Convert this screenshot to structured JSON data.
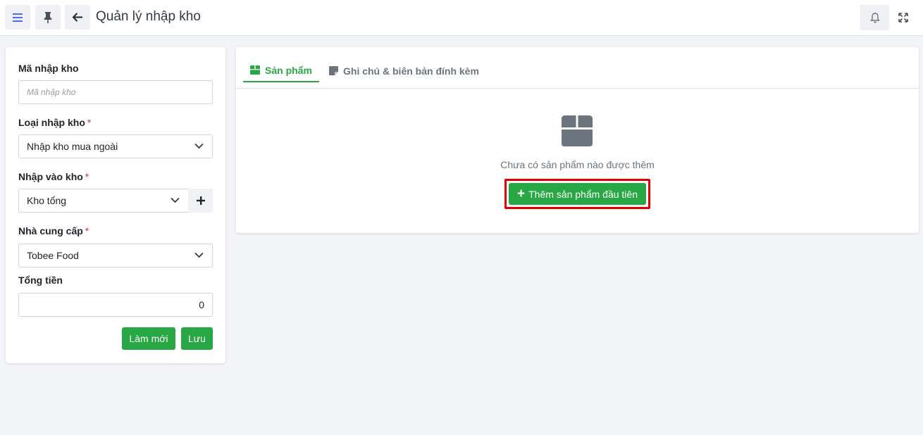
{
  "header": {
    "title": "Quản lý nhập kho",
    "menu_icon": "hamburger-icon",
    "pin_icon": "pin-icon",
    "back_icon": "arrow-left-icon",
    "bell_icon": "bell-icon",
    "expand_icon": "expand-icon"
  },
  "form": {
    "code_label": "Mã nhập kho",
    "code_placeholder": "Mã nhập kho",
    "type_label": "Loại nhập kho",
    "type_value": "Nhập kho mua ngoài",
    "warehouse_label": "Nhập vào kho",
    "warehouse_value": "Kho tổng",
    "supplier_label": "Nhà cung cấp",
    "supplier_value": "Tobee Food",
    "total_label": "Tổng tiền",
    "total_value": "0",
    "required_mark": "*",
    "add_warehouse_symbol": "+",
    "reset_label": "Làm mới",
    "save_label": "Lưu"
  },
  "tabs": [
    {
      "label": "Sản phẩm",
      "active": true,
      "icon": "box-icon"
    },
    {
      "label": "Ghi chú & biên bản đính kèm",
      "active": false,
      "icon": "sticky-note-icon"
    }
  ],
  "empty_state": {
    "icon": "box-icon",
    "message": "Chưa có sản phẩm nào được thêm",
    "button_label": "Thêm sản phẩm đầu tiên",
    "button_symbol": "+"
  },
  "colors": {
    "accent_green": "#28a745",
    "highlight_red": "#e00000",
    "required_red": "#dc3545",
    "hamburger_blue": "#4a6cf7"
  }
}
